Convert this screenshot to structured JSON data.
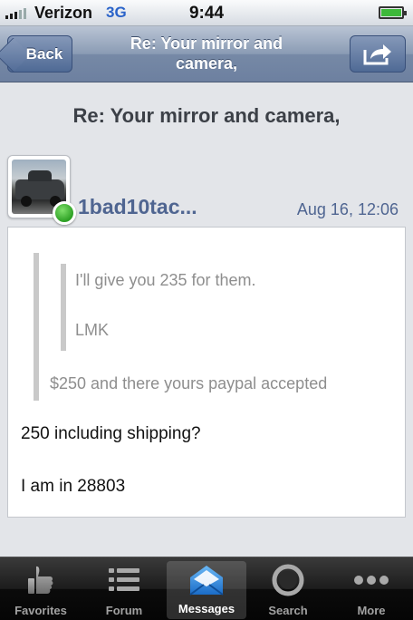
{
  "status_bar": {
    "carrier": "Verizon",
    "network": "3G",
    "time": "9:44",
    "battery_level": 1.0
  },
  "nav": {
    "back_label": "Back",
    "title": "Re: Your mirror and camera,",
    "share_icon": "share-icon"
  },
  "thread": {
    "title": "Re: Your mirror and camera,"
  },
  "post": {
    "author": "1bad10tac...",
    "date": "Aug 16, 12:06",
    "online": true,
    "inner_quote": [
      "I'll give you 235 for them.",
      "LMK"
    ],
    "outer_quote": "$250 and there yours paypal accepted",
    "body": [
      "250 including shipping?",
      "I am in 28803"
    ]
  },
  "tabs": [
    {
      "label": "Favorites",
      "icon": "thumbs-up-icon",
      "active": false
    },
    {
      "label": "Forum",
      "icon": "list-icon",
      "active": false
    },
    {
      "label": "Messages",
      "icon": "envelope-icon",
      "active": true
    },
    {
      "label": "Search",
      "icon": "magnifier-icon",
      "active": false
    },
    {
      "label": "More",
      "icon": "more-dots-icon",
      "active": false
    }
  ]
}
